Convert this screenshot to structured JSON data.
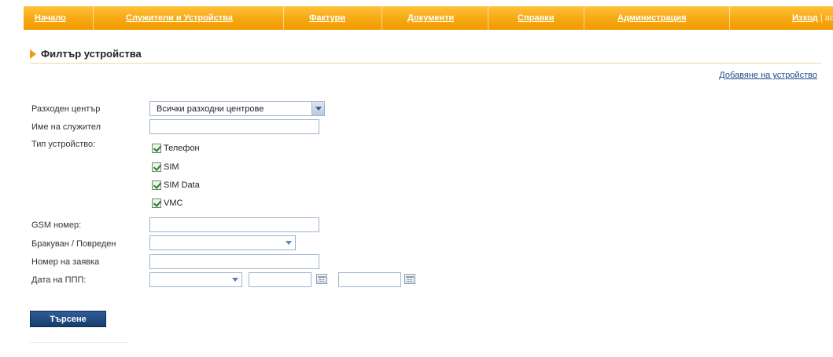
{
  "nav": {
    "items": [
      "Начало",
      "Служители и Устройства",
      "Фактури",
      "Документи",
      "Справки",
      "Администрация"
    ],
    "logout": "Изход",
    "user": " | adm"
  },
  "heading": {
    "title": "Филтър устройства"
  },
  "add_link": "Добавяне на устройство",
  "form": {
    "cost_center": {
      "label": "Разходен център",
      "value": "Всички разходни центрове"
    },
    "employee_name": {
      "label": "Име на служител",
      "value": ""
    },
    "device_type": {
      "label": "Тип устройство:",
      "options": [
        {
          "label": "Телефон",
          "checked": true
        },
        {
          "label": "SIM",
          "checked": true
        },
        {
          "label": "SIM Data",
          "checked": true
        },
        {
          "label": "VMC",
          "checked": true
        }
      ]
    },
    "gsm_number": {
      "label": "GSM номер:",
      "value": ""
    },
    "defective": {
      "label": "Бракуван / Повреден",
      "value": ""
    },
    "request_number": {
      "label": "Номер на заявка",
      "value": ""
    },
    "ppp_date": {
      "label": "Дата на ППП:",
      "value": "",
      "from": "",
      "to": ""
    }
  },
  "search_button": "Търсене",
  "colors": {
    "nav": "#f29c00",
    "button": "#1f477d",
    "link": "#1b4a8a"
  }
}
